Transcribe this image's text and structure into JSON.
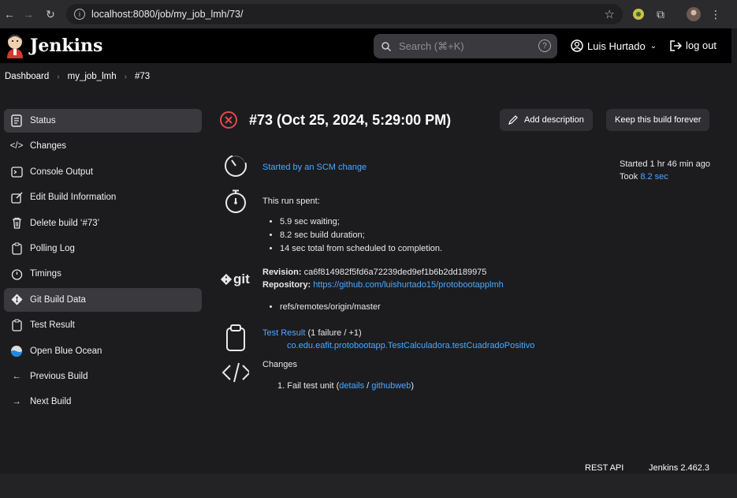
{
  "browser": {
    "url": "localhost:8080/job/my_job_lmh/73/"
  },
  "header": {
    "brand": "Jenkins",
    "search_placeholder": "Search (⌘+K)",
    "user_name": "Luis Hurtado",
    "logout_label": "log out"
  },
  "breadcrumb": [
    "Dashboard",
    "my_job_lmh",
    "#73"
  ],
  "sidebar": {
    "items": [
      {
        "label": "Status",
        "icon": "document-icon"
      },
      {
        "label": "Changes",
        "icon": "code-icon"
      },
      {
        "label": "Console Output",
        "icon": "terminal-icon"
      },
      {
        "label": "Edit Build Information",
        "icon": "edit-icon"
      },
      {
        "label": "Delete build ‘#73’",
        "icon": "trash-icon"
      },
      {
        "label": "Polling Log",
        "icon": "clipboard-icon"
      },
      {
        "label": "Timings",
        "icon": "stopwatch-icon"
      },
      {
        "label": "Git Build Data",
        "icon": "git-icon"
      },
      {
        "label": "Test Result",
        "icon": "clipboard-icon"
      },
      {
        "label": "Open Blue Ocean",
        "icon": "blue-ocean-icon"
      },
      {
        "label": "Previous Build",
        "icon": "arrow-left-icon"
      },
      {
        "label": "Next Build",
        "icon": "arrow-right-icon"
      }
    ]
  },
  "main": {
    "title": "#73 (Oct 25, 2024, 5:29:00 PM)",
    "add_description": "Add description",
    "keep_forever": "Keep this build forever",
    "started_by": "Started by an SCM change",
    "started_ago": "Started 1 hr 46 min ago",
    "took_label": "Took",
    "took_value": "8.2 sec",
    "run_spent": "This run spent:",
    "spent_items": [
      "5.9 sec waiting;",
      "8.2 sec build duration;",
      "14 sec total from scheduled to completion."
    ],
    "git_logo_text": "git",
    "revision_label": "Revision:",
    "revision_value": "ca6f814982f5fd6a72239ded9ef1b6b2dd189975",
    "repository_label": "Repository:",
    "repository_url": "https://github.com/luishurtado15/protobootapplmh",
    "ref": "refs/remotes/origin/master",
    "test_result_link": "Test Result",
    "test_result_summary": "(1 failure / +1)",
    "test_case": "co.edu.eafit.protobootapp.TestCalculadora.testCuadradoPositivo",
    "changes_label": "Changes",
    "change_item_text": "Fail test unit (",
    "change_details": "details",
    "change_sep": " / ",
    "change_githubweb": "githubweb",
    "change_close": ")",
    "change_number": "1."
  },
  "footer": {
    "rest_api": "REST API",
    "version": "Jenkins 2.462.3"
  },
  "colors": {
    "accent_link": "#4aa9ff",
    "failure_red": "#e5484d",
    "background": "#1c1c1f"
  }
}
